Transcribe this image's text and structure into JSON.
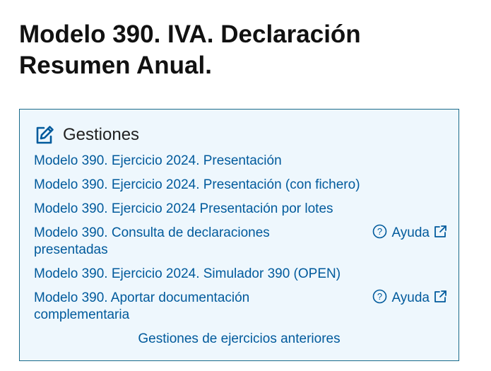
{
  "page": {
    "title": "Modelo 390. IVA. Declaración Resumen Anual."
  },
  "gestiones": {
    "heading": "Gestiones",
    "icon": "edit-icon",
    "accent_color": "#005a9c",
    "border_color": "#1a6a8a",
    "background_color": "#eef7fd",
    "links": [
      {
        "label": "Modelo 390. Ejercicio 2024. Presentación"
      },
      {
        "label": "Modelo 390. Ejercicio 2024. Presentación (con fichero)"
      },
      {
        "label": "Modelo 390. Ejercicio 2024 Presentación por lotes"
      },
      {
        "label": "Modelo 390. Consulta de declaraciones presentadas",
        "help": "Ayuda"
      },
      {
        "label": "Modelo 390. Ejercicio 2024. Simulador 390 (OPEN)"
      },
      {
        "label": "Modelo 390. Aportar documentación complementaria",
        "help": "Ayuda"
      }
    ],
    "previous_years_link": "Gestiones de ejercicios anteriores"
  }
}
